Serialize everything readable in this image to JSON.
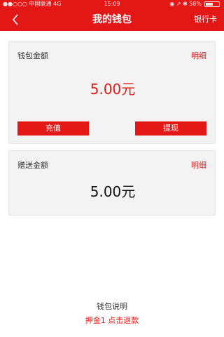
{
  "statusbar": {
    "carrier": "●●○○○ 中国联通  4G",
    "time": "15:09",
    "indicators": "◉ ↗ ✱ 58%",
    "battery_percent": 58
  },
  "navbar": {
    "back_icon": "chevron-left",
    "title": "我的钱包",
    "right_link": "银行卡"
  },
  "wallet": {
    "label": "钱包金额",
    "detail": "明细",
    "amount": "5.00元",
    "recharge": "充值",
    "withdraw": "提现"
  },
  "gift": {
    "label": "赠送金额",
    "detail": "明细",
    "amount": "5.00元"
  },
  "footer": {
    "description": "钱包说明",
    "deposit_link": "押金1 点击退款"
  },
  "colors": {
    "primary": "#e41717",
    "card_bg": "#f3f3f3"
  }
}
